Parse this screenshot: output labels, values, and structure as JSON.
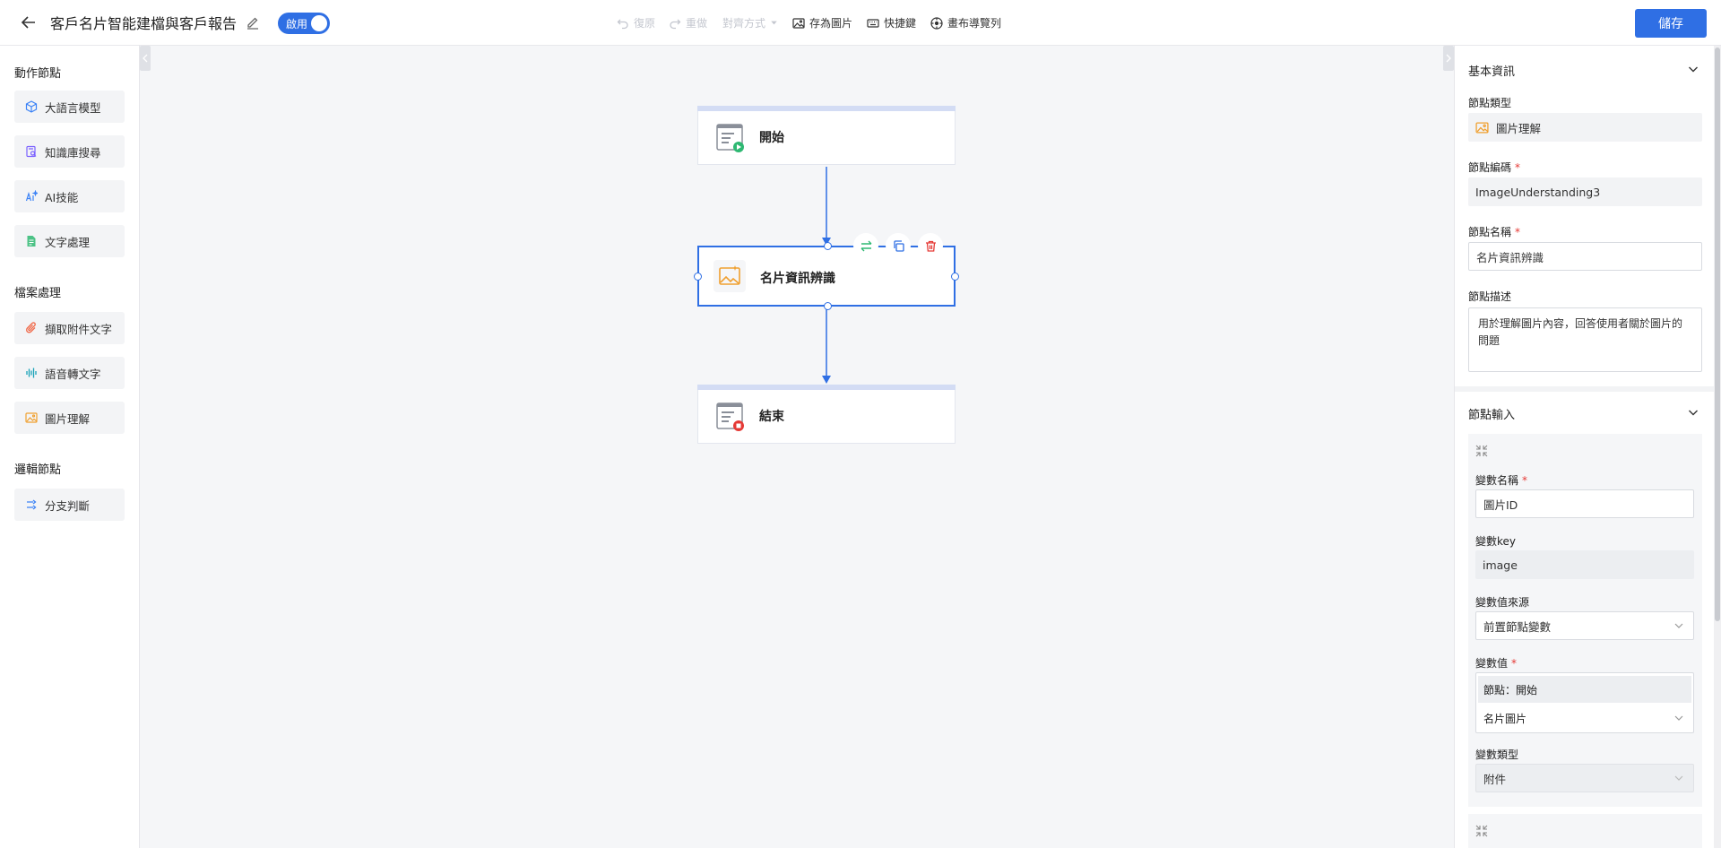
{
  "header": {
    "title": "客戶名片智能建檔與客戶報告",
    "toggle_label": "啟用",
    "tools": {
      "undo": "復原",
      "redo": "重做",
      "align": "對齊方式",
      "save_image": "存為圖片",
      "shortcuts": "快捷鍵",
      "canvas_nav": "畫布導覽列"
    },
    "save_label": "儲存"
  },
  "sidebar": {
    "groups": [
      {
        "title": "動作節點",
        "items": [
          "大語言模型",
          "知識庫搜尋",
          "AI技能",
          "文字處理"
        ]
      },
      {
        "title": "檔案處理",
        "items": [
          "擷取附件文字",
          "語音轉文字",
          "圖片理解"
        ]
      },
      {
        "title": "邏輯節點",
        "items": [
          "分支判斷"
        ]
      }
    ]
  },
  "canvas": {
    "nodes": [
      {
        "label": "開始"
      },
      {
        "label": "名片資訊辨識"
      },
      {
        "label": "結束"
      }
    ]
  },
  "panel": {
    "basic_info_title": "基本資訊",
    "node_type_label": "節點類型",
    "node_type_value": "圖片理解",
    "node_code_label": "節點編碼",
    "node_code_value": "ImageUnderstanding3",
    "node_name_label": "節點名稱",
    "node_name_value": "名片資訊辨識",
    "node_desc_label": "節點描述",
    "node_desc_value": "用於理解圖片內容，回答使用者關於圖片的問題",
    "node_input_title": "節點輸入",
    "var_name_label": "變數名稱",
    "var_name_value": "圖片ID",
    "var_key_label": "變數key",
    "var_key_value": "image",
    "var_source_label": "變數值來源",
    "var_source_value": "前置節點變數",
    "var_value_label": "變數值",
    "var_value_node": "節點：開始",
    "var_value_select": "名片圖片",
    "var_type_label": "變數類型",
    "var_type_value": "附件"
  },
  "colors": {
    "accent": "#2f6fe4",
    "start_badge": "#2eb872",
    "end_badge": "#e53935",
    "image_icon": "#f0a030"
  }
}
